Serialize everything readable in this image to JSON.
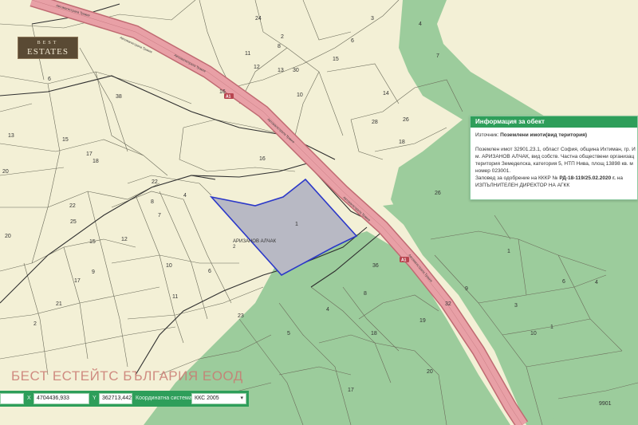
{
  "branding": {
    "logo_top": "BEST",
    "logo_main": "ESTATES",
    "watermark": "БЕСТ ЕСТЕЙТС БЪЛГАРИЯ ЕООД"
  },
  "map": {
    "road_shield": "A1",
    "road_names": [
      "Автомагистрала Тракия",
      "Автомагистрала Тракия",
      "Автомагистрала Тракия",
      "Автомагистрала Тракия",
      "Автомагистрала Тракия",
      "Автомагистрала Тракия"
    ],
    "selected_parcel_label": "1",
    "locality_label": "АРИЗАНОВ АЛЧАК",
    "locality_sub": "2",
    "parcel_labels": [
      "3",
      "4",
      "2",
      "6",
      "7",
      "8",
      "24",
      "11",
      "12",
      "13",
      "30",
      "15",
      "10",
      "16",
      "14",
      "28",
      "26",
      "18",
      "38",
      "15",
      "13",
      "17",
      "18",
      "20",
      "22",
      "25",
      "21",
      "16",
      "12",
      "17",
      "10",
      "8",
      "22",
      "4",
      "6",
      "7",
      "9",
      "11",
      "20",
      "23",
      "15",
      "36",
      "4",
      "8",
      "18",
      "19",
      "32",
      "17",
      "20",
      "26",
      "2",
      "1",
      "9",
      "4",
      "3",
      "10",
      "6",
      "1",
      "6",
      "9901",
      "5"
    ],
    "colors": {
      "background": "#f3f0d6",
      "forest": "#9ccc9c",
      "road": "#e8a0a6",
      "selected_fill": "#b8b9c4",
      "selected_stroke": "#2b38c9",
      "accent": "#2e9e5a"
    }
  },
  "info_panel": {
    "title": "Информация за обект",
    "source_label": "Източник:",
    "source_value": "Поземлени имоти(вид територия)",
    "lines": [
      "Поземлен имот 32901.23.1, област София, община Ихтиман, гр. И",
      "м. АРИЗАНОВ АЛЧАК, вид собств. Частна обществени организац",
      "територия Земеделска, категория 5, НТП Нива, площ 13898 кв. м",
      "номер 023001."
    ],
    "order_prefix": "Заповед за одобрение на КККР №",
    "order_value": "РД-18-119/25.02.2020 г.",
    "order_suffix": "на",
    "issuer": "ИЗПЪЛНИТЕЛЕН ДИРЕКТОР НА АГКК"
  },
  "coords": {
    "x_label": "X",
    "x_value": "4704436,933",
    "y_label": "Y",
    "y_value": "362713,442",
    "system_label": "Координатна система",
    "system_value": "ККС 2005"
  }
}
